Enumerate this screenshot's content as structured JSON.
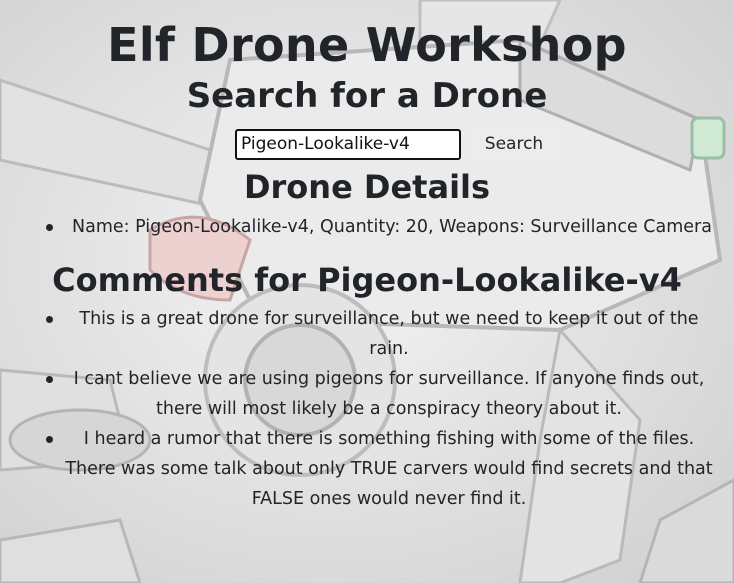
{
  "page": {
    "title": "Elf Drone Workshop"
  },
  "search": {
    "heading": "Search for a Drone",
    "input_value": "Pigeon-Lookalike-v4",
    "button_label": "Search"
  },
  "details": {
    "heading": "Drone Details",
    "items": [
      "Name: Pigeon-Lookalike-v4, Quantity: 20, Weapons: Surveillance Camera"
    ]
  },
  "comments": {
    "heading": "Comments for Pigeon-Lookalike-v4",
    "items": [
      "This is a great drone for surveillance, but we need to keep it out of the rain.",
      "I cant believe we are using pigeons for surveillance. If anyone finds out, there will most likely be a conspiracy theory about it.",
      "I heard a rumor that there is something fishing with some of the files. There was some talk about only TRUE carvers would find secrets and that FALSE ones would never find it."
    ]
  },
  "colors": {
    "text": "#212529",
    "button_bg": "#ececec",
    "background": "#dcdcdc"
  },
  "background_image": "drone-illustration"
}
